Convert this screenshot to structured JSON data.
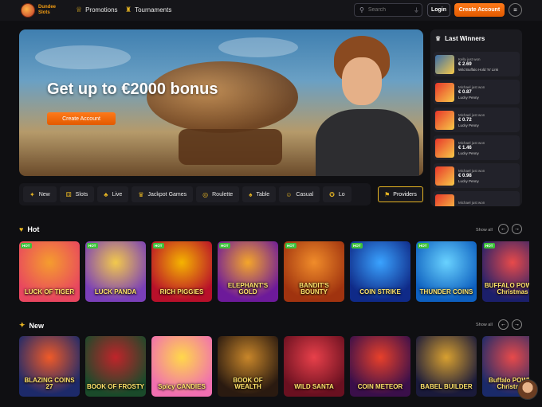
{
  "header": {
    "logo_line1": "Dundee",
    "logo_line2": "Slots",
    "nav": [
      {
        "label": "Promotions",
        "icon": "trophy-icon"
      },
      {
        "label": "Tournaments",
        "icon": "cup-icon"
      }
    ],
    "search_placeholder": "Search",
    "login_label": "Login",
    "create_label": "Create Account"
  },
  "banner": {
    "title": "Get up to €2000 bonus",
    "cta": "Create Account"
  },
  "winners": {
    "title": "Last Winners",
    "items": [
      {
        "who": "Kelly just won",
        "amount": "€ 2.69",
        "game": "Wild Buffalo Hold 'N' Link"
      },
      {
        "who": "Michael just won",
        "amount": "€ 0.87",
        "game": "Lucky Penny"
      },
      {
        "who": "Michael just won",
        "amount": "€ 0.72",
        "game": "Lucky Penny"
      },
      {
        "who": "Michael just won",
        "amount": "€ 1.46",
        "game": "Lucky Penny"
      },
      {
        "who": "Michael just won",
        "amount": "€ 0.98",
        "game": "Lucky Penny"
      },
      {
        "who": "Michael just won",
        "amount": "",
        "game": ""
      }
    ]
  },
  "categories": [
    {
      "label": "New",
      "icon": "sparkle-icon"
    },
    {
      "label": "Slots",
      "icon": "slot-icon"
    },
    {
      "label": "Live",
      "icon": "live-icon"
    },
    {
      "label": "Jackpot Games",
      "icon": "jackpot-icon"
    },
    {
      "label": "Roulette",
      "icon": "roulette-icon"
    },
    {
      "label": "Table",
      "icon": "cards-icon"
    },
    {
      "label": "Casual",
      "icon": "casual-icon"
    },
    {
      "label": "Lo",
      "icon": "lottery-icon"
    }
  ],
  "providers_label": "Providers",
  "hot": {
    "title": "Hot",
    "show_all": "Show all",
    "tag": "HOT",
    "games": [
      {
        "name": "LUCK OF TIGER",
        "colors": [
          "#e8465f",
          "#f59d2e"
        ]
      },
      {
        "name": "LUCK PANDA",
        "colors": [
          "#7a3fb8",
          "#f2c94c"
        ]
      },
      {
        "name": "RICH PIGGIES",
        "colors": [
          "#b8102a",
          "#f5b400"
        ]
      },
      {
        "name": "ELEPHANT'S GOLD",
        "colors": [
          "#6d1a9a",
          "#f4a62a"
        ]
      },
      {
        "name": "BANDIT'S BOUNTY",
        "colors": [
          "#a0330f",
          "#f08c2a"
        ]
      },
      {
        "name": "COIN STRIKE",
        "colors": [
          "#0f2a88",
          "#3aa3ff"
        ]
      },
      {
        "name": "THUNDER COINS",
        "colors": [
          "#0d5fbf",
          "#69d2ff"
        ]
      },
      {
        "name": "BUFFALO POWER Christmas",
        "colors": [
          "#1b1f6b",
          "#e84a4a"
        ]
      }
    ]
  },
  "new": {
    "title": "New",
    "show_all": "Show all",
    "games": [
      {
        "name": "BLAZING COINS 27",
        "colors": [
          "#1d2a6a",
          "#f05a28"
        ]
      },
      {
        "name": "BOOK OF FROSTY",
        "colors": [
          "#1a4a2a",
          "#c0242a"
        ]
      },
      {
        "name": "Spicy CANDIES",
        "colors": [
          "#f06fb0",
          "#ffd84a"
        ]
      },
      {
        "name": "BOOK OF WEALTH",
        "colors": [
          "#2a1a10",
          "#c8862a"
        ]
      },
      {
        "name": "WILD SANTA",
        "colors": [
          "#6a1020",
          "#e8404a"
        ]
      },
      {
        "name": "COIN METEOR",
        "colors": [
          "#3a0f4a",
          "#e8402a"
        ]
      },
      {
        "name": "BABEL BUILDER",
        "colors": [
          "#1a1a3a",
          "#d8a030"
        ]
      },
      {
        "name": "Buffalo POWER Christmas",
        "colors": [
          "#1a2a6a",
          "#e84a4a"
        ]
      }
    ]
  },
  "winner_thumb_colors": [
    "#3a6ea8",
    "#e8362a",
    "#e8362a",
    "#e8362a",
    "#e8362a",
    "#e8362a"
  ]
}
